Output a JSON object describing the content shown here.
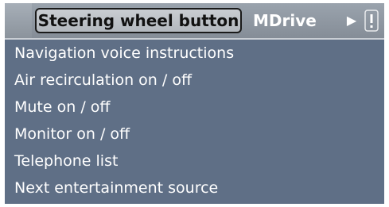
{
  "tabs": {
    "active": "Steering wheel button",
    "next": "MDrive"
  },
  "icons": {
    "scroll_right": "play-arrow-icon",
    "info": "info-bar-icon"
  },
  "menu": {
    "items": [
      "Navigation voice instructions",
      "Air recirculation on / off",
      "Mute on / off",
      "Monitor on / off",
      "Telephone list",
      "Next entertainment source"
    ]
  },
  "colors": {
    "background": "#5f6f86",
    "tab_bar": "#8f97a1",
    "text": "#ffffff"
  }
}
